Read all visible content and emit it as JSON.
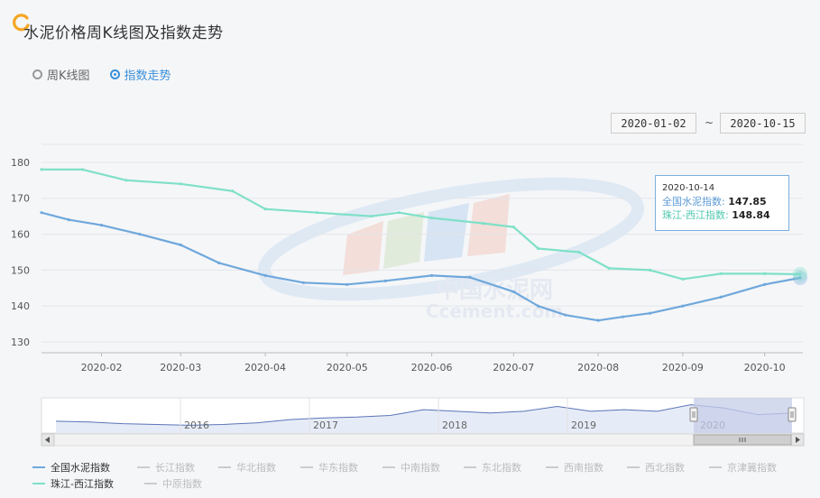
{
  "header": {
    "title": "水泥价格周K线图及指数走势"
  },
  "view_toggle": {
    "options": [
      "周K线图",
      "指数走势"
    ],
    "selected": "指数走势"
  },
  "date_range": {
    "start": "2020-01-02",
    "separator": "~",
    "end": "2020-10-15"
  },
  "tooltip": {
    "date": "2020-10-14",
    "series": [
      {
        "name": "全国水泥指数",
        "value": "147.85"
      },
      {
        "name": "珠江-西江指数",
        "value": "148.84"
      }
    ]
  },
  "watermark": {
    "line1": "中国水泥网",
    "line2": "Ccement.com"
  },
  "colors": {
    "national": "#6fa8dc",
    "pearl": "#7fe0c8",
    "accent": "#3a8fd9",
    "navigator_fill": "#c5cde8"
  },
  "chart_data": {
    "type": "line",
    "x_tick_labels": [
      "2020-02",
      "2020-03",
      "2020-04",
      "2020-05",
      "2020-06",
      "2020-07",
      "2020-08",
      "2020-09",
      "2020-10"
    ],
    "y_tick_labels": [
      "130",
      "140",
      "150",
      "160",
      "170",
      "180"
    ],
    "ylim": [
      127,
      185
    ],
    "grid": true,
    "legend_position": "bottom",
    "series": [
      {
        "name": "全国水泥指数",
        "color": "#6fa8dc",
        "x": [
          "2020-01-10",
          "2020-01-20",
          "2020-02-01",
          "2020-02-15",
          "2020-03-01",
          "2020-03-15",
          "2020-04-01",
          "2020-04-15",
          "2020-05-01",
          "2020-05-15",
          "2020-06-01",
          "2020-06-15",
          "2020-07-01",
          "2020-07-10",
          "2020-07-20",
          "2020-08-01",
          "2020-08-10",
          "2020-08-20",
          "2020-09-01",
          "2020-09-15",
          "2020-10-01",
          "2020-10-14"
        ],
        "values": [
          166,
          164,
          162.5,
          160,
          157,
          152,
          148.5,
          146.5,
          146,
          147,
          148.5,
          148,
          144,
          140,
          137.5,
          136,
          137,
          138,
          140,
          142.5,
          146,
          147.85
        ]
      },
      {
        "name": "珠江-西江指数",
        "color": "#7fe0c8",
        "x": [
          "2020-01-10",
          "2020-01-25",
          "2020-02-10",
          "2020-03-01",
          "2020-03-20",
          "2020-04-01",
          "2020-04-20",
          "2020-05-10",
          "2020-05-20",
          "2020-06-01",
          "2020-06-20",
          "2020-07-01",
          "2020-07-10",
          "2020-07-25",
          "2020-08-05",
          "2020-08-20",
          "2020-09-01",
          "2020-09-15",
          "2020-10-01",
          "2020-10-14"
        ],
        "values": [
          178,
          178,
          175,
          174,
          172,
          167,
          166,
          165,
          166,
          164.5,
          163,
          162,
          156,
          155,
          150.5,
          150,
          147.5,
          149,
          149,
          148.84
        ]
      }
    ]
  },
  "navigator": {
    "year_labels": [
      "2016",
      "2017",
      "2018",
      "2019",
      "2020"
    ],
    "values": [
      138,
      137,
      135,
      134,
      133,
      134,
      136,
      140,
      142,
      143,
      145,
      152,
      150,
      148,
      150,
      156,
      150,
      152,
      150,
      158,
      154,
      146,
      148
    ]
  },
  "legend": [
    {
      "label": "全国水泥指数",
      "on": true
    },
    {
      "label": "长江指数",
      "on": false
    },
    {
      "label": "华北指数",
      "on": false
    },
    {
      "label": "华东指数",
      "on": false
    },
    {
      "label": "中南指数",
      "on": false
    },
    {
      "label": "东北指数",
      "on": false
    },
    {
      "label": "西南指数",
      "on": false
    },
    {
      "label": "西北指数",
      "on": false
    },
    {
      "label": "京津冀指数",
      "on": false
    },
    {
      "label": "珠江-西江指数",
      "on": true
    },
    {
      "label": "中原指数",
      "on": false
    }
  ]
}
